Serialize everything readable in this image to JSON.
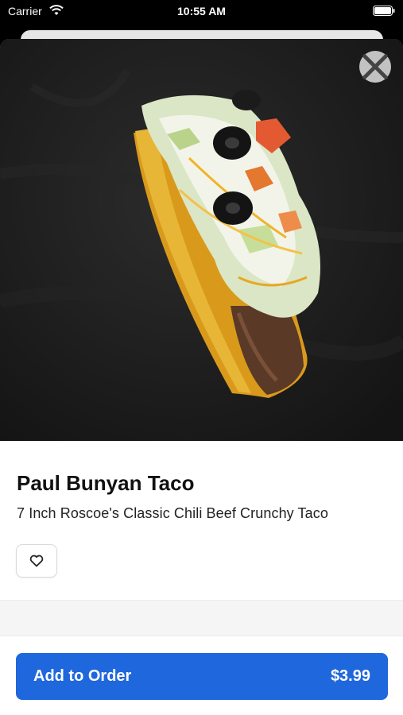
{
  "status_bar": {
    "carrier": "Carrier",
    "time": "10:55 AM"
  },
  "item": {
    "title": "Paul Bunyan Taco",
    "description": "7 Inch Roscoe's Classic Chili Beef Crunchy Taco",
    "image_alt": "Paul Bunyan Taco photo"
  },
  "actions": {
    "add_label": "Add to Order",
    "price": "$3.99"
  },
  "icons": {
    "close": "close-icon",
    "favorite": "heart-outline-icon",
    "wifi": "wifi-icon",
    "battery": "battery-icon"
  },
  "colors": {
    "accent": "#1f67dd",
    "background": "#ffffff",
    "photo_bg": "#1a1a1a"
  }
}
